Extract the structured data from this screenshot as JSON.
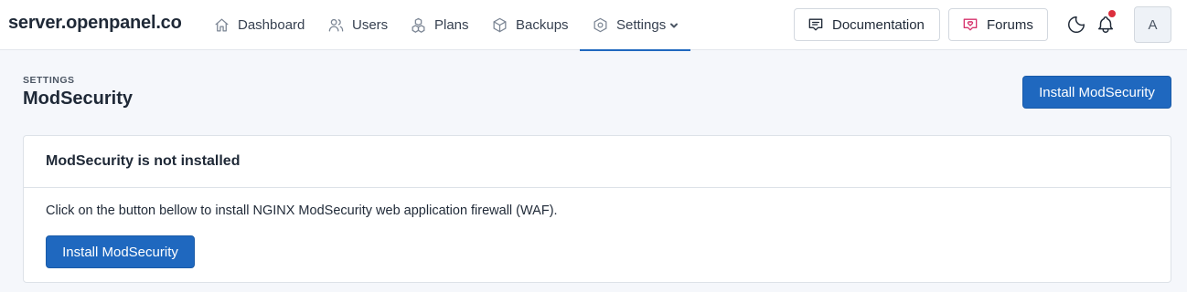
{
  "brand": "server.openpanel.co",
  "nav": {
    "items": [
      {
        "label": "Dashboard",
        "icon": "home-icon"
      },
      {
        "label": "Users",
        "icon": "users-icon"
      },
      {
        "label": "Plans",
        "icon": "plans-icon"
      },
      {
        "label": "Backups",
        "icon": "box-icon"
      },
      {
        "label": "Settings",
        "icon": "hexagon-settings-icon",
        "active": true
      }
    ]
  },
  "header_actions": {
    "documentation_label": "Documentation",
    "forums_label": "Forums",
    "avatar_initial": "A",
    "notifications_unread": true
  },
  "page": {
    "pretitle": "SETTINGS",
    "title": "ModSecurity",
    "action_label": "Install ModSecurity"
  },
  "card": {
    "title": "ModSecurity is not installed",
    "description": "Click on the button bellow to install NGINX ModSecurity web application firewall (WAF).",
    "button_label": "Install ModSecurity"
  },
  "colors": {
    "primary": "#1f68bf",
    "forums_accent": "#d6336c",
    "notification_dot": "#dc2f3d",
    "background": "#f5f7fb"
  }
}
